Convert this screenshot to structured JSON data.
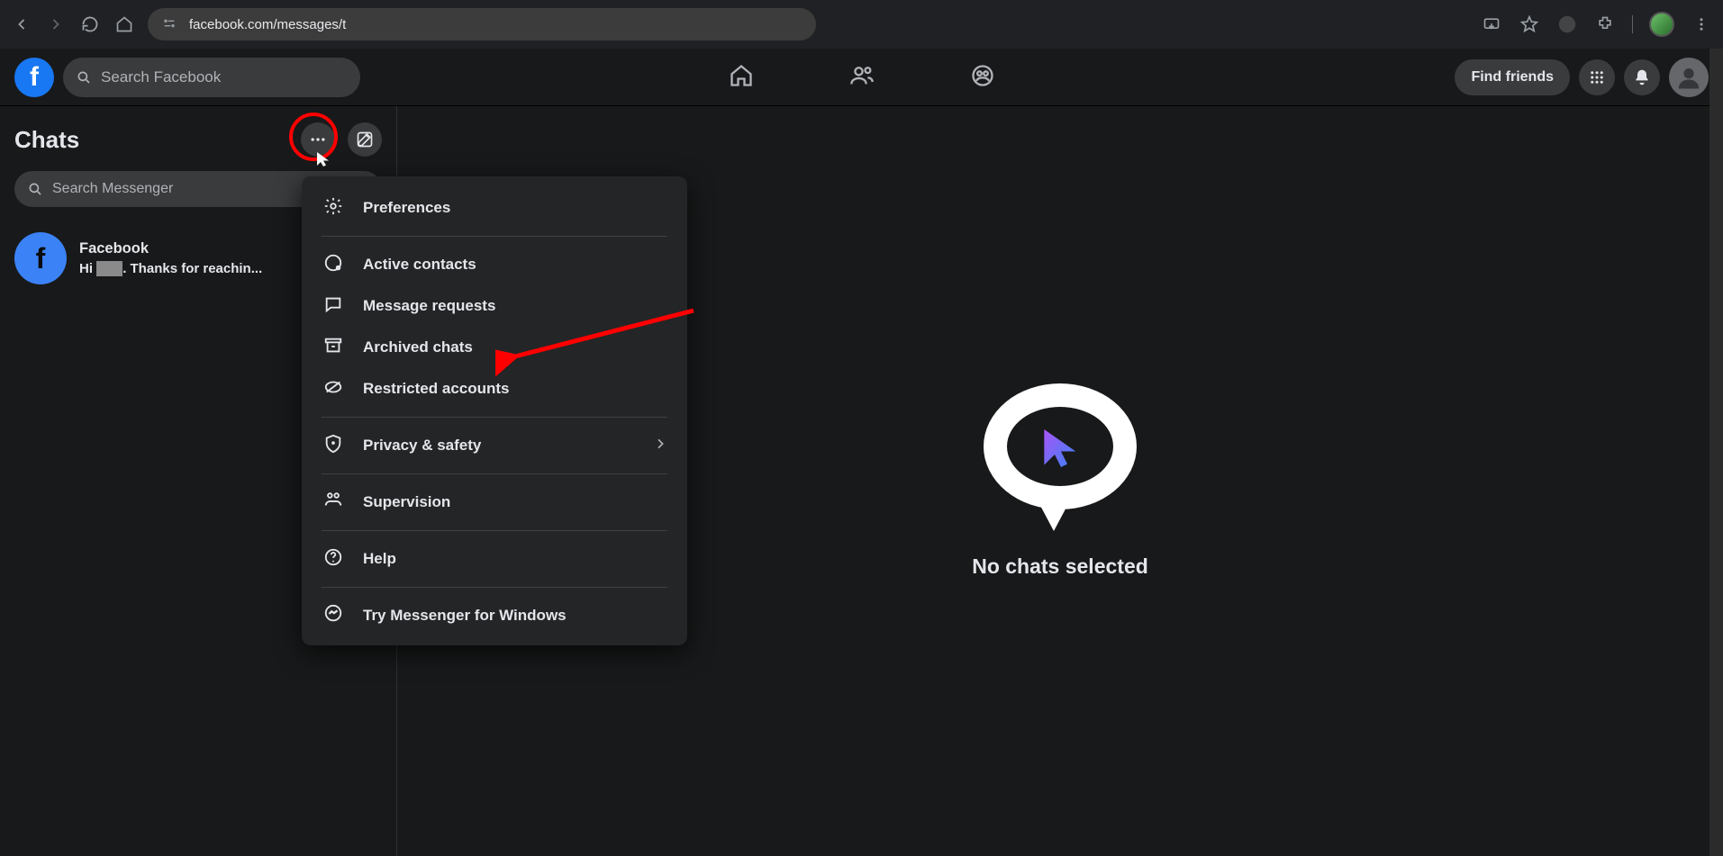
{
  "browser": {
    "url": "facebook.com/messages/t"
  },
  "fb": {
    "search_placeholder": "Search Facebook",
    "find_friends": "Find friends"
  },
  "sidebar": {
    "title": "Chats",
    "search_placeholder": "Search Messenger",
    "chat": {
      "name": "Facebook",
      "preview_prefix": "Hi ",
      "preview_suffix": ". Thanks for reachin..."
    }
  },
  "menu": {
    "preferences": "Preferences",
    "active_contacts": "Active contacts",
    "message_requests": "Message requests",
    "archived_chats": "Archived chats",
    "restricted_accounts": "Restricted accounts",
    "privacy_safety": "Privacy & safety",
    "supervision": "Supervision",
    "help": "Help",
    "try_messenger": "Try Messenger for Windows"
  },
  "main": {
    "empty_title": "No chats selected"
  }
}
